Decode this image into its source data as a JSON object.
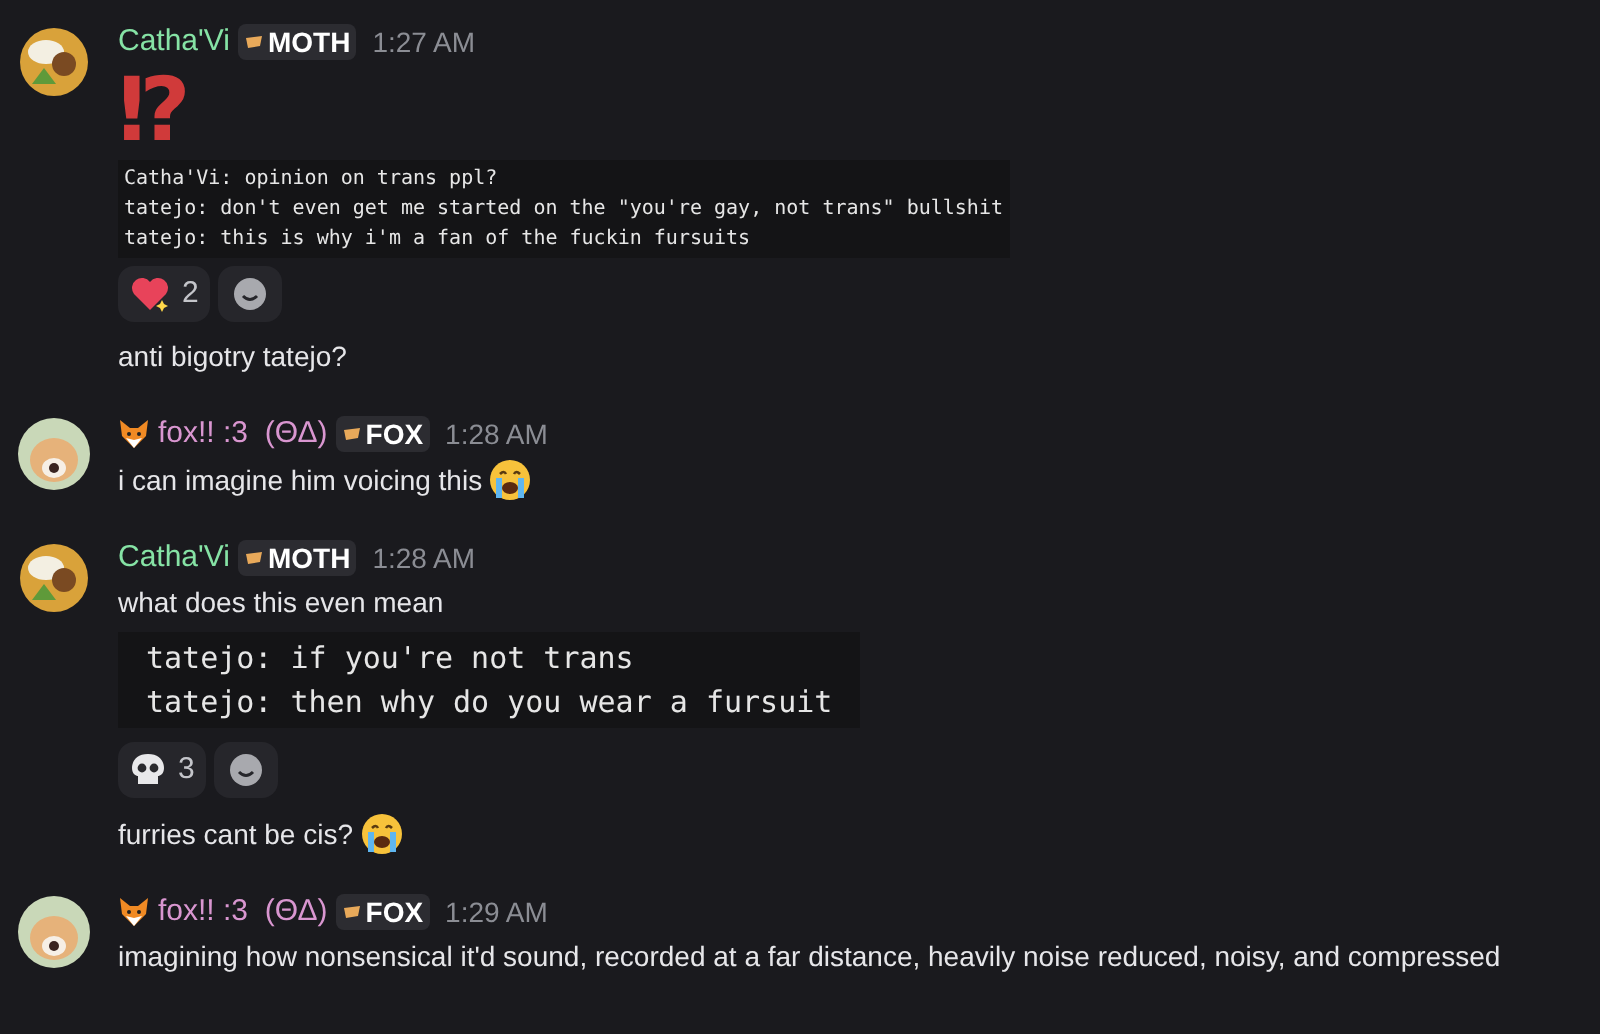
{
  "messages": [
    {
      "kind": "moth",
      "author": "Catha'Vi",
      "color": "#86e3a5",
      "tag": "MOTH",
      "time": "1:27 AM",
      "blocks": [
        {
          "kind": "symbol",
          "text": "⁉"
        },
        {
          "kind": "snippet",
          "lines": [
            "Catha'Vi: opinion on trans ppl?",
            "tatejo: don't even get me started on the \"you're gay, not trans\" bullshit",
            "tatejo: this is why i'm a fan of the fuckin fursuits"
          ]
        },
        {
          "kind": "reactions",
          "items": [
            {
              "kind": "heart",
              "count": "2"
            }
          ]
        },
        {
          "kind": "text",
          "text": "anti bigotry tatejo?"
        }
      ]
    },
    {
      "kind": "fox",
      "author": "fox!! :3  (ΘΔ)",
      "color": "#d996d0",
      "tag": "FOX",
      "time": "1:28 AM",
      "blocks": [
        {
          "kind": "crying",
          "text": "i can imagine him voicing this"
        }
      ]
    },
    {
      "kind": "moth",
      "author": "Catha'Vi",
      "color": "#86e3a5",
      "tag": "MOTH",
      "time": "1:28 AM",
      "blocks": [
        {
          "kind": "text",
          "text": "what does this even mean"
        },
        {
          "kind": "screenshot",
          "lines": [
            "tatejo: if you're not trans",
            "tatejo: then why do you wear a fursuit"
          ]
        },
        {
          "kind": "reactions",
          "items": [
            {
              "kind": "skull",
              "count": "3"
            }
          ]
        },
        {
          "kind": "crying",
          "text": "furries cant be cis?"
        }
      ]
    },
    {
      "kind": "fox",
      "author": "fox!! :3  (ΘΔ)",
      "color": "#d996d0",
      "tag": "FOX",
      "time": "1:29 AM",
      "blocks": [
        {
          "kind": "text",
          "text": "imagining how nonsensical it'd sound, recorded at a far distance, heavily noise reduced, noisy, and compressed"
        }
      ]
    }
  ]
}
